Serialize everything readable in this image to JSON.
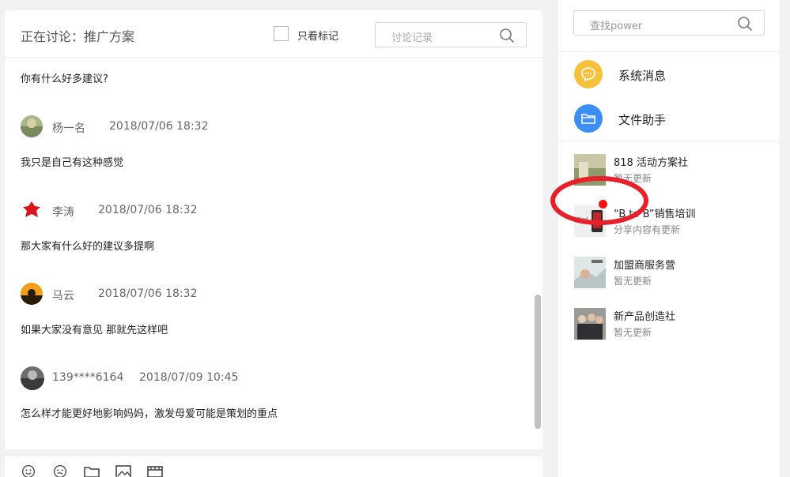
{
  "chat": {
    "title": "正在讨论：推广方案",
    "mark_only_label": "只看标记",
    "history_search_placeholder": "讨论记录",
    "first_message": "你有什么好多建议?",
    "messages": [
      {
        "author": "杨一名",
        "time": "2018/07/06 18:32",
        "text": "我只是自己有这种感觉"
      },
      {
        "author": "李涛",
        "time": "2018/07/06 18:32",
        "text": "那大家有什么好的建议多提啊"
      },
      {
        "author": "马云",
        "time": "2018/07/06 18:32",
        "text": "如果大家没有意见 那就先这样吧"
      },
      {
        "author": "139****6164",
        "time": "2018/07/09 10:45",
        "text": "怎么样才能更好地影响妈妈，激发母爱可能是策划的重点"
      }
    ],
    "toolbar_icons": [
      "smiley-icon",
      "sticker-icon",
      "folder-icon",
      "image-icon",
      "video-icon"
    ]
  },
  "sidebar": {
    "search_placeholder": "查找power",
    "system_items": [
      {
        "label": "系统消息",
        "icon": "chat-bubble-icon",
        "color": "#f7c23b"
      },
      {
        "label": "文件助手",
        "icon": "folder-icon",
        "color": "#3c8ef5"
      }
    ],
    "groups": [
      {
        "name": "818 活动方案社",
        "status": "暂无更新"
      },
      {
        "name": "“B  to  B”销售培训",
        "status": "分享内容有更新"
      },
      {
        "name": "加盟商服务营",
        "status": "暂无更新"
      },
      {
        "name": "新产品创造社",
        "status": "暂无更新"
      }
    ]
  },
  "colors": {
    "annotation_red": "#e8202a",
    "unread_dot": "#ff1010"
  }
}
